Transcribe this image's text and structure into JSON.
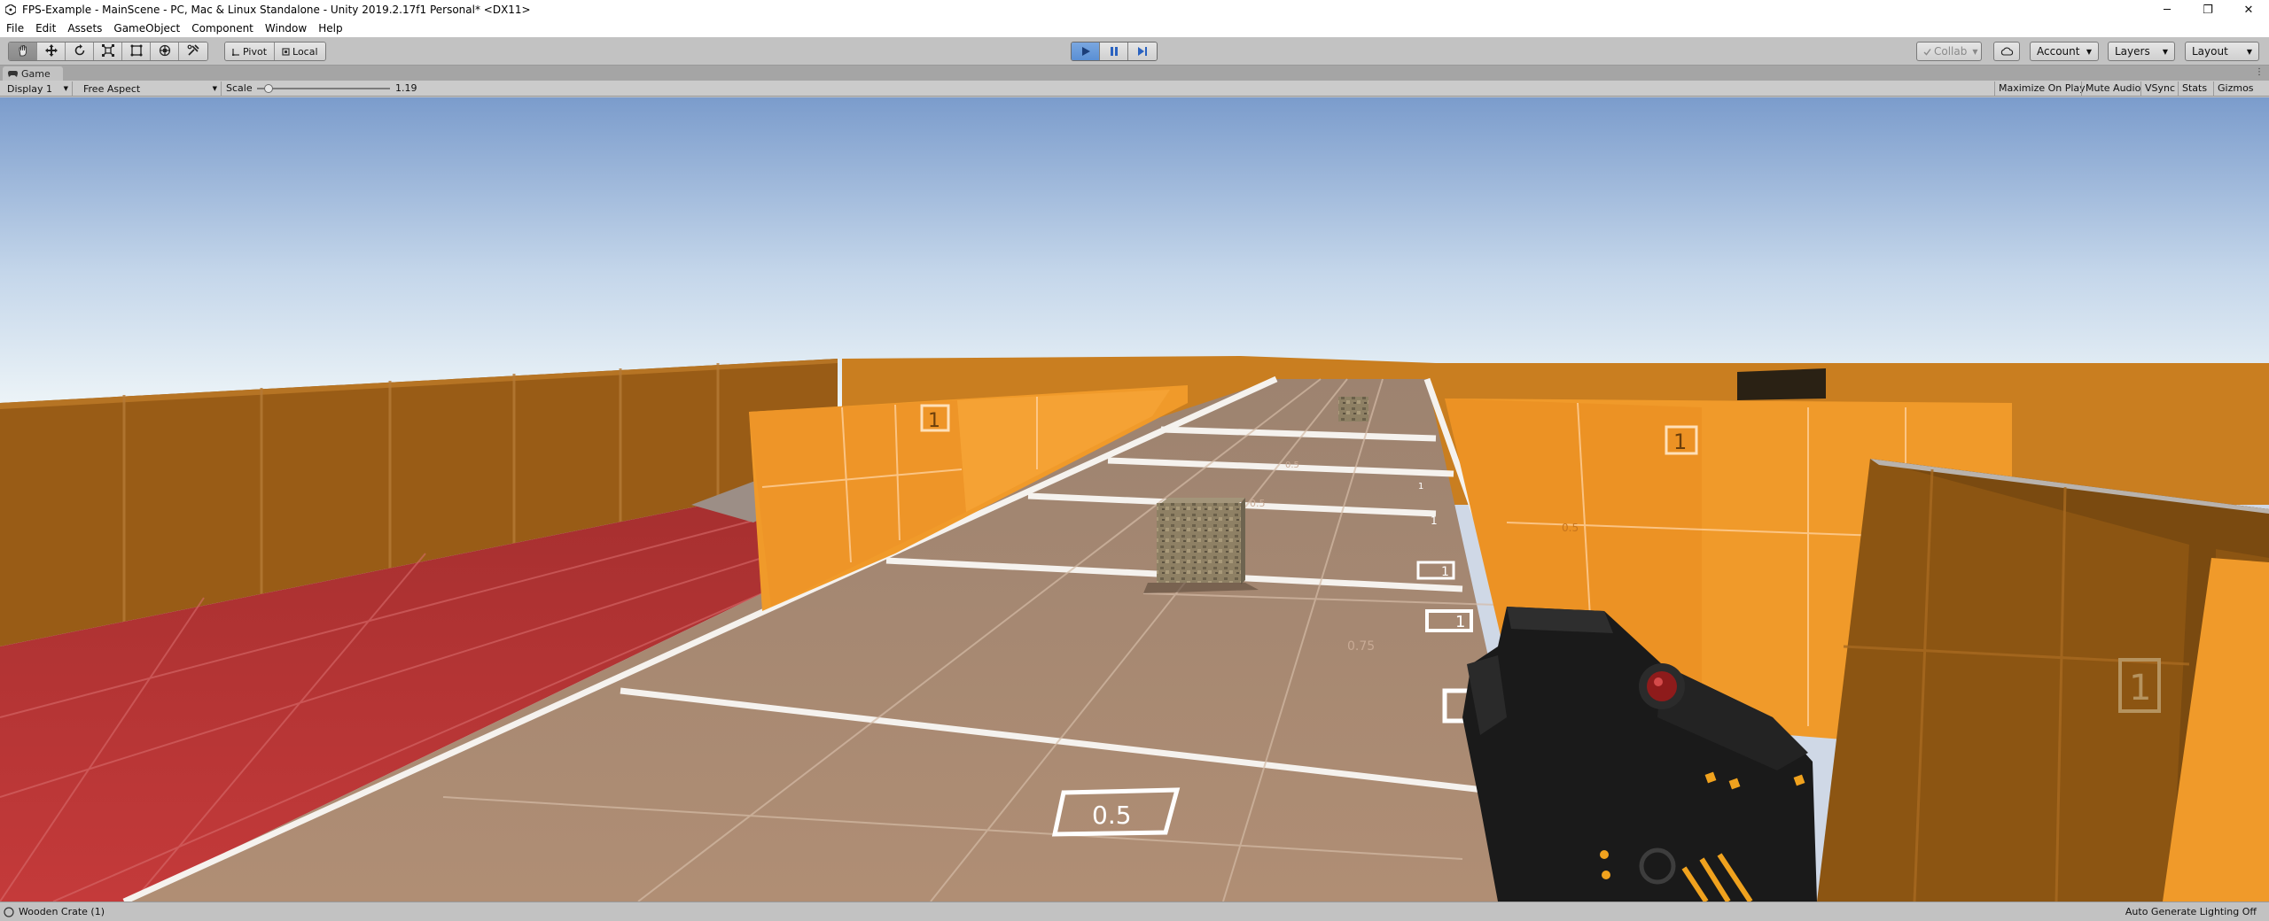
{
  "window": {
    "title": "FPS-Example - MainScene - PC, Mac & Linux Standalone - Unity 2019.2.17f1 Personal* <DX11>",
    "controls": {
      "minimize": "─",
      "maximize": "❐",
      "close": "✕"
    }
  },
  "menu": [
    "File",
    "Edit",
    "Assets",
    "GameObject",
    "Component",
    "Window",
    "Help"
  ],
  "toolbar": {
    "tools": [
      "hand-icon",
      "move-icon",
      "rotate-icon",
      "scale-icon",
      "rect-icon",
      "transform-icon",
      "custom-tool-icon"
    ],
    "pivot_label": "Pivot",
    "local_label": "Local",
    "play_state": {
      "play": true,
      "pause": false,
      "step": false
    },
    "collab_label": "Collab",
    "account_label": "Account",
    "layers_label": "Layers",
    "layout_label": "Layout"
  },
  "game_tab": {
    "label": "Game",
    "icon": "game-controller-icon"
  },
  "game_bar": {
    "display": "Display 1",
    "aspect": "Free Aspect",
    "scale_label": "Scale",
    "scale_value": "1.19",
    "scale_level": 0.05,
    "maximize_on_play": "Maximize On Play",
    "mute_audio": "Mute Audio",
    "vsync": "VSync",
    "stats": "Stats",
    "gizmos": "Gizmos"
  },
  "scene": {
    "markers": [
      "1",
      "1",
      "1",
      "1",
      "1",
      "1",
      "1",
      "1",
      "0.5",
      "0.75",
      "0.5",
      "0.5",
      "0.5"
    ],
    "colors": {
      "sky_top": "#7b9ccc",
      "sky_horizon": "#eef5f8",
      "floor": "#a9876d",
      "red_floor": "#b63434",
      "orange_wall": "#f09a2a",
      "dark_wall": "#8c5512",
      "gun": "#1a1a1a"
    }
  },
  "status": {
    "message": "Wooden Crate (1)",
    "right": "Auto Generate Lighting Off"
  }
}
